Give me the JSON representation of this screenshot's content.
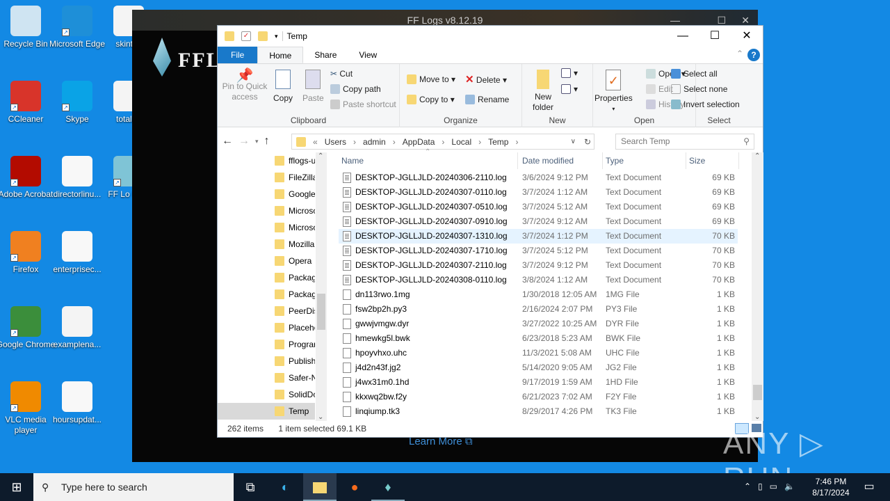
{
  "desktop": {
    "icons": [
      {
        "label": "Recycle Bin",
        "icon": "recycle-bin-icon"
      },
      {
        "label": "Microsoft Edge",
        "icon": "edge-icon"
      },
      {
        "label": "skintes",
        "icon": "image-file-icon"
      },
      {
        "label": "CCleaner",
        "icon": "ccleaner-icon"
      },
      {
        "label": "Skype",
        "icon": "skype-icon"
      },
      {
        "label": "totalan",
        "icon": "image-file-icon"
      },
      {
        "label": "Adobe Acrobat",
        "icon": "acrobat-icon"
      },
      {
        "label": "directorlinu...",
        "icon": "word-doc-icon"
      },
      {
        "label": "FF Lo Uplo",
        "icon": "fflogs-icon"
      },
      {
        "label": "Firefox",
        "icon": "firefox-icon"
      },
      {
        "label": "enterprisec...",
        "icon": "word-doc-icon"
      },
      {
        "label": "Google Chrome",
        "icon": "chrome-icon"
      },
      {
        "label": "examplena...",
        "icon": "image-file-icon"
      },
      {
        "label": "VLC media player",
        "icon": "vlc-icon"
      },
      {
        "label": "hoursupdat...",
        "icon": "word-doc-icon"
      }
    ]
  },
  "fflogs": {
    "title": "FF Logs v8.12.19",
    "logo": "FFLOGS",
    "learn_more": "Learn More"
  },
  "explorer": {
    "title": "Temp",
    "tabs": [
      "File",
      "Home",
      "Share",
      "View"
    ],
    "ribbon": {
      "clipboard": {
        "pin": "Pin to Quick access",
        "copy": "Copy",
        "paste": "Paste",
        "cut": "Cut",
        "copy_path": "Copy path",
        "paste_shortcut": "Paste shortcut",
        "label": "Clipboard"
      },
      "organize": {
        "move_to": "Move to",
        "copy_to": "Copy to",
        "delete": "Delete",
        "rename": "Rename",
        "label": "Organize"
      },
      "new": {
        "new_folder": "New folder",
        "label": "New"
      },
      "open": {
        "properties": "Properties",
        "open": "Open",
        "edit": "Edit",
        "history": "History",
        "label": "Open"
      },
      "select": {
        "select_all": "Select all",
        "select_none": "Select none",
        "invert": "Invert selection",
        "label": "Select"
      }
    },
    "address": {
      "path": [
        "Users",
        "admin",
        "AppData",
        "Local",
        "Temp"
      ],
      "search_placeholder": "Search Temp"
    },
    "nav": [
      "fflogs-u",
      "FileZilla",
      "Google",
      "Microso",
      "Microso",
      "Mozilla",
      "Opera",
      "Packag",
      "Packag",
      "PeerDis",
      "Placeho",
      "Prograr",
      "Publish",
      "Safer-N",
      "SolidDc",
      "Temp"
    ],
    "nav_selected": "Temp",
    "columns": [
      "Name",
      "Date modified",
      "Type",
      "Size"
    ],
    "files": [
      {
        "name": "DESKTOP-JGLLJLD-20240306-2110.log",
        "date": "3/6/2024 9:12 PM",
        "type": "Text Document",
        "size": "69 KB",
        "kind": "txt"
      },
      {
        "name": "DESKTOP-JGLLJLD-20240307-0110.log",
        "date": "3/7/2024 1:12 AM",
        "type": "Text Document",
        "size": "69 KB",
        "kind": "txt"
      },
      {
        "name": "DESKTOP-JGLLJLD-20240307-0510.log",
        "date": "3/7/2024 5:12 AM",
        "type": "Text Document",
        "size": "69 KB",
        "kind": "txt"
      },
      {
        "name": "DESKTOP-JGLLJLD-20240307-0910.log",
        "date": "3/7/2024 9:12 AM",
        "type": "Text Document",
        "size": "69 KB",
        "kind": "txt"
      },
      {
        "name": "DESKTOP-JGLLJLD-20240307-1310.log",
        "date": "3/7/2024 1:12 PM",
        "type": "Text Document",
        "size": "70 KB",
        "kind": "txt",
        "selected": true
      },
      {
        "name": "DESKTOP-JGLLJLD-20240307-1710.log",
        "date": "3/7/2024 5:12 PM",
        "type": "Text Document",
        "size": "70 KB",
        "kind": "txt"
      },
      {
        "name": "DESKTOP-JGLLJLD-20240307-2110.log",
        "date": "3/7/2024 9:12 PM",
        "type": "Text Document",
        "size": "70 KB",
        "kind": "txt"
      },
      {
        "name": "DESKTOP-JGLLJLD-20240308-0110.log",
        "date": "3/8/2024 1:12 AM",
        "type": "Text Document",
        "size": "70 KB",
        "kind": "txt"
      },
      {
        "name": "dn113rwo.1mg",
        "date": "1/30/2018 12:05 AM",
        "type": "1MG File",
        "size": "1 KB",
        "kind": "blank"
      },
      {
        "name": "fsw2bp2h.py3",
        "date": "2/16/2024 2:07 PM",
        "type": "PY3 File",
        "size": "1 KB",
        "kind": "blank"
      },
      {
        "name": "gwwjvmgw.dyr",
        "date": "3/27/2022 10:25 AM",
        "type": "DYR File",
        "size": "1 KB",
        "kind": "blank"
      },
      {
        "name": "hmewkg5l.bwk",
        "date": "6/23/2018 5:23 AM",
        "type": "BWK File",
        "size": "1 KB",
        "kind": "blank"
      },
      {
        "name": "hpoyvhxo.uhc",
        "date": "11/3/2021 5:08 AM",
        "type": "UHC File",
        "size": "1 KB",
        "kind": "blank"
      },
      {
        "name": "j4d2n43f.jg2",
        "date": "5/14/2020 9:05 AM",
        "type": "JG2 File",
        "size": "1 KB",
        "kind": "blank"
      },
      {
        "name": "j4wx31m0.1hd",
        "date": "9/17/2019 1:59 AM",
        "type": "1HD File",
        "size": "1 KB",
        "kind": "blank"
      },
      {
        "name": "kkxwq2bw.f2y",
        "date": "6/21/2023 7:02 AM",
        "type": "F2Y File",
        "size": "1 KB",
        "kind": "blank"
      },
      {
        "name": "linqiump.tk3",
        "date": "8/29/2017 4:26 PM",
        "type": "TK3 File",
        "size": "1 KB",
        "kind": "blank"
      }
    ],
    "status": {
      "count": "262 items",
      "selection": "1 item selected  69.1 KB"
    }
  },
  "taskbar": {
    "search_placeholder": "Type here to search",
    "time": "7:46 PM",
    "date": "8/17/2024"
  },
  "watermark": "ANY RUN"
}
